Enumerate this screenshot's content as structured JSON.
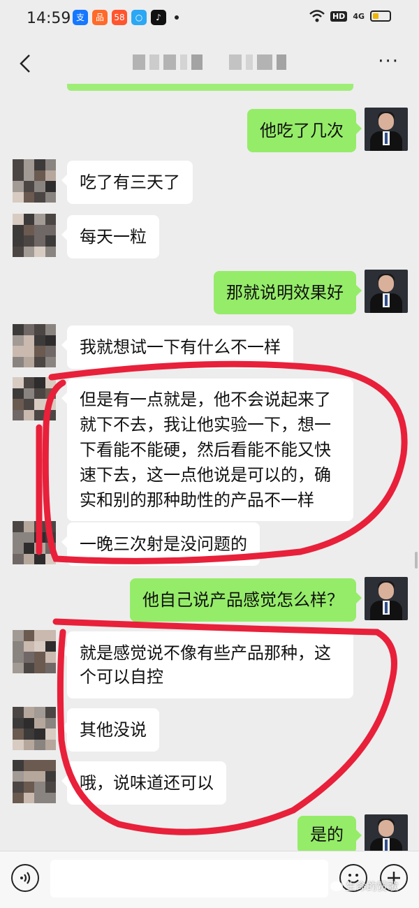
{
  "status_bar": {
    "time": "14:59",
    "app_icons": [
      {
        "name": "alipay-icon",
        "glyph": "支",
        "color": "#1677ff"
      },
      {
        "name": "notes-icon",
        "glyph": "品",
        "color": "#ff6a2a"
      },
      {
        "name": "58-icon",
        "glyph": "58",
        "color": "#ff552e"
      },
      {
        "name": "browser-icon",
        "glyph": "○",
        "color": "#2ba7f4"
      },
      {
        "name": "tiktok-icon",
        "glyph": "♪",
        "color": "#111111"
      }
    ],
    "hd_label": "HD",
    "network_label": "4G",
    "battery_level": 0.35
  },
  "nav": {
    "back_icon": "chevron-left-icon",
    "more_label": "···"
  },
  "messages": [
    {
      "side": "out",
      "text": "他吃了几次"
    },
    {
      "side": "in",
      "text": "吃了有三天了"
    },
    {
      "side": "in",
      "text": "每天一粒"
    },
    {
      "side": "out",
      "text": "那就说明效果好"
    },
    {
      "side": "in",
      "text": "我就想试一下有什么不一样"
    },
    {
      "side": "in",
      "text": "但是有一点就是，他不会说起来了就下不去，我让他实验一下，想一下看能不能硬，然后看能不能又快速下去，这一点他说是可以的，确实和别的那种助性的产品不一样"
    },
    {
      "side": "in",
      "text": "一晚三次射是没问题的"
    },
    {
      "side": "out",
      "text": "他自己说产品感觉怎么样？"
    },
    {
      "side": "in",
      "text": "就是感觉说不像有些产品那种，这个可以自控"
    },
    {
      "side": "in",
      "text": "其他没说"
    },
    {
      "side": "in",
      "text": "哦，说味道还可以"
    },
    {
      "side": "out",
      "text": "是的"
    }
  ],
  "input_bar": {
    "voice_icon": "voice-icon",
    "emoji_icon": "emoji-icon",
    "plus_icon": "plus-icon",
    "placeholder": ""
  },
  "watermark": {
    "text": "生命的赞歌"
  },
  "colors": {
    "outgoing_bubble": "#95ec69",
    "incoming_bubble": "#ffffff",
    "background": "#ededed",
    "annotation": "#e8203a"
  }
}
